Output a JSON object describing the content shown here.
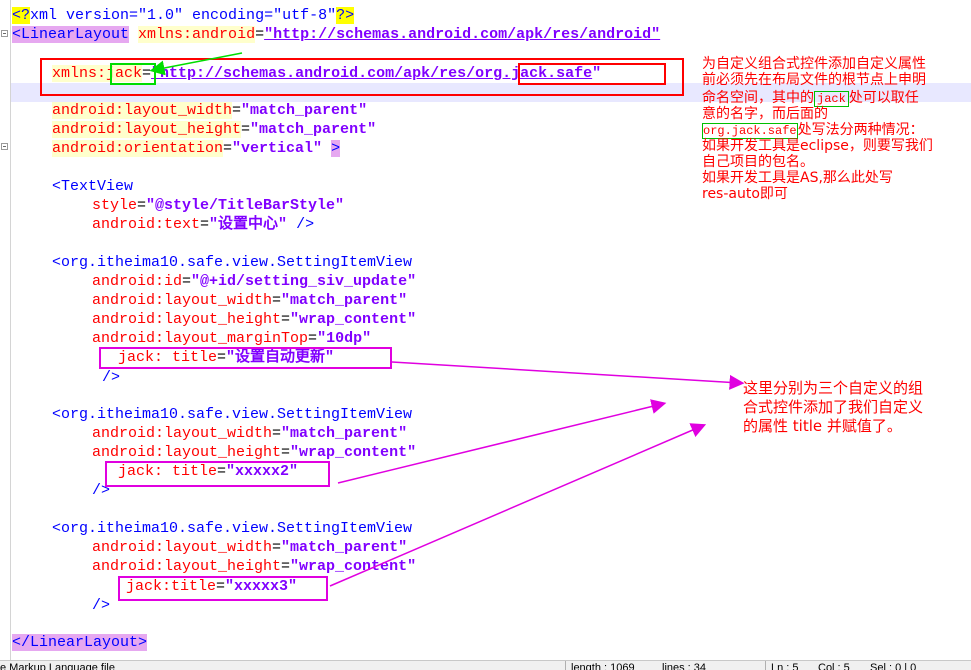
{
  "code": {
    "decl_open": "<?",
    "decl_name": "xml",
    "decl_attrs": " version=\"1.0\" encoding=\"utf-8\"",
    "decl_close": "?>",
    "ll_open": "<LinearLayout",
    "xmlns_android_attr": "xmlns:android",
    "eq": "=",
    "xmlns_android_val": "\"http://schemas.android.com/apk/res/android\"",
    "xmlns_prefix": "xmlns:",
    "jack": "jack",
    "xmlns_jack_val_a": "\"http://schemas.android.com/apk/res/",
    "xmlns_jack_val_b": "org.jack.safe",
    "quote": "\"",
    "lw_attr": "android:layout_width",
    "lw_val": "\"match_parent\"",
    "lh_attr": "android:layout_height",
    "lh_val": "\"match_parent\"",
    "or_attr": "android:orientation",
    "or_val": "\"vertical\"",
    "gt": ">",
    "tv_open": "<TextView",
    "style_attr": "style",
    "style_val": "\"@style/TitleBarStyle\"",
    "text_attr": "android:text",
    "text_val": "\"设置中心\"",
    "selfclose": "/>",
    "siv_open": "<org.itheima10.safe.view.SettingItemView",
    "id_attr": "android:id",
    "id_val": "\"@+id/setting_siv_update\"",
    "wrap_val": "\"wrap_content\"",
    "mt_attr": "android:layout_marginTop",
    "mt_val": "\"10dp\"",
    "jack_title_1": "jack: title",
    "title1_val": "\"设置自动更新\"",
    "jack_title_2": "jack: title",
    "title2_val": "\"xxxxx2\"",
    "jack_title_3_a": "jack:",
    "jack_title_3_b": "title",
    "title3_val": "\"xxxxx3\"",
    "ll_close": "</LinearLayout>"
  },
  "annotations": {
    "note1": [
      "为自定义组合式控件添加自定义属性",
      "前必须先在布局文件的根节点上申明",
      "命名空间，其中的"
    ],
    "note1_jack": "jack",
    "note1_line3_tail": "处可以取任",
    "note1_line4": "意的名字，而后面的",
    "note1_pkg": "org.jack.safe",
    "note1_line5_tail": "处写法分两种情况：",
    "note1_rest": [
      "如果开发工具是eclipse，则要写我们",
      "自己项目的包名。",
      "如果开发工具是AS,那么此处写",
      "res-auto即可"
    ],
    "note2": [
      "这里分别为三个自定义的组",
      "合式控件添加了我们自定义",
      "的属性 title 并赋值了。"
    ]
  },
  "status": {
    "file_type": "e Markup Language file",
    "length": "length : 1069",
    "lines": "lines : 34",
    "ln": "Ln : 5",
    "col": "Col : 5",
    "sel": "Sel : 0 | 0"
  },
  "colors": {
    "red_box": "#ff0000",
    "green_box": "#00dd00",
    "magenta_box": "#e000e0",
    "annotation_text": "#ff0000"
  }
}
